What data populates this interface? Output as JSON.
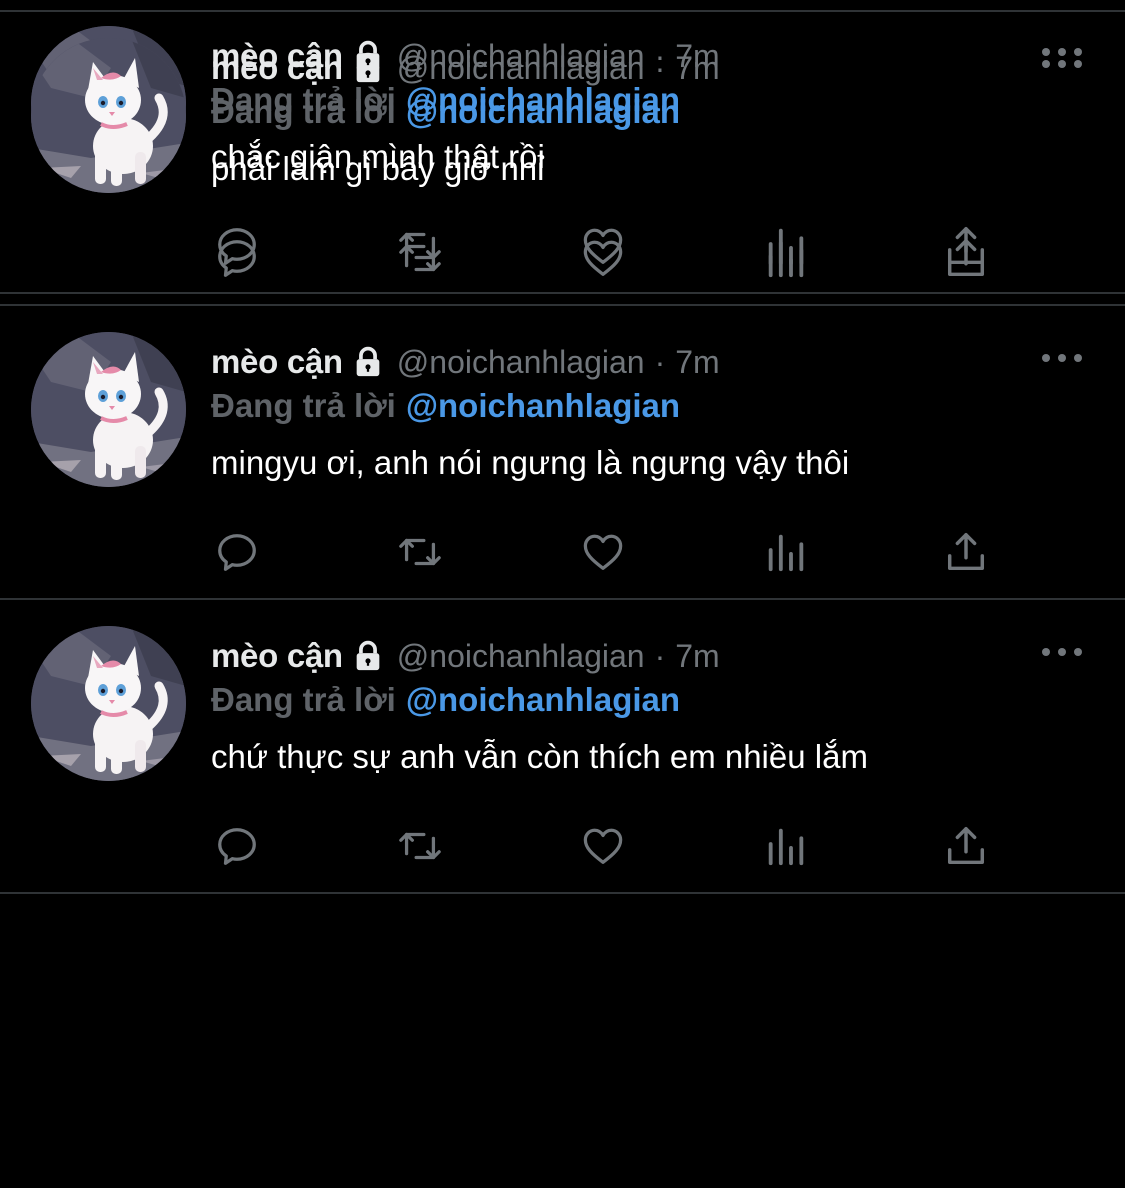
{
  "colors": {
    "background": "#000000",
    "divider": "#2f3336",
    "primary_text": "#e7e9ea",
    "secondary_text": "#71767b",
    "mention": "#4a98e6",
    "icon": "#71767b"
  },
  "icons": {
    "lock": "lock-icon",
    "more": "more-icon",
    "reply": "reply-icon",
    "retweet": "retweet-icon",
    "like": "heart-icon",
    "views": "views-icon",
    "share": "share-icon"
  },
  "tweets": [
    {
      "display_name": "mèo cận",
      "handle": "@noichanhlagian",
      "separator": "·",
      "time": "7m",
      "reply_prefix": "Đang trả lời",
      "reply_mention": "@noichanhlagian",
      "text": "chắc giận mình thật rồi"
    },
    {
      "display_name": "mèo cận",
      "handle": "@noichanhlagian",
      "separator": "·",
      "time": "7m",
      "reply_prefix": "Đang trả lời",
      "reply_mention": "@noichanhlagian",
      "text": "phải làm gì bây giờ nhỉ"
    },
    {
      "display_name": "mèo cận",
      "handle": "@noichanhlagian",
      "separator": "·",
      "time": "7m",
      "reply_prefix": "Đang trả lời",
      "reply_mention": "@noichanhlagian",
      "text": "mingyu ơi, anh nói ngưng là ngưng vậy thôi"
    },
    {
      "display_name": "mèo cận",
      "handle": "@noichanhlagian",
      "separator": "·",
      "time": "7m",
      "reply_prefix": "Đang trả lời",
      "reply_mention": "@noichanhlagian",
      "text": "chứ thực sự anh vẫn còn thích em nhiều lắm"
    }
  ]
}
